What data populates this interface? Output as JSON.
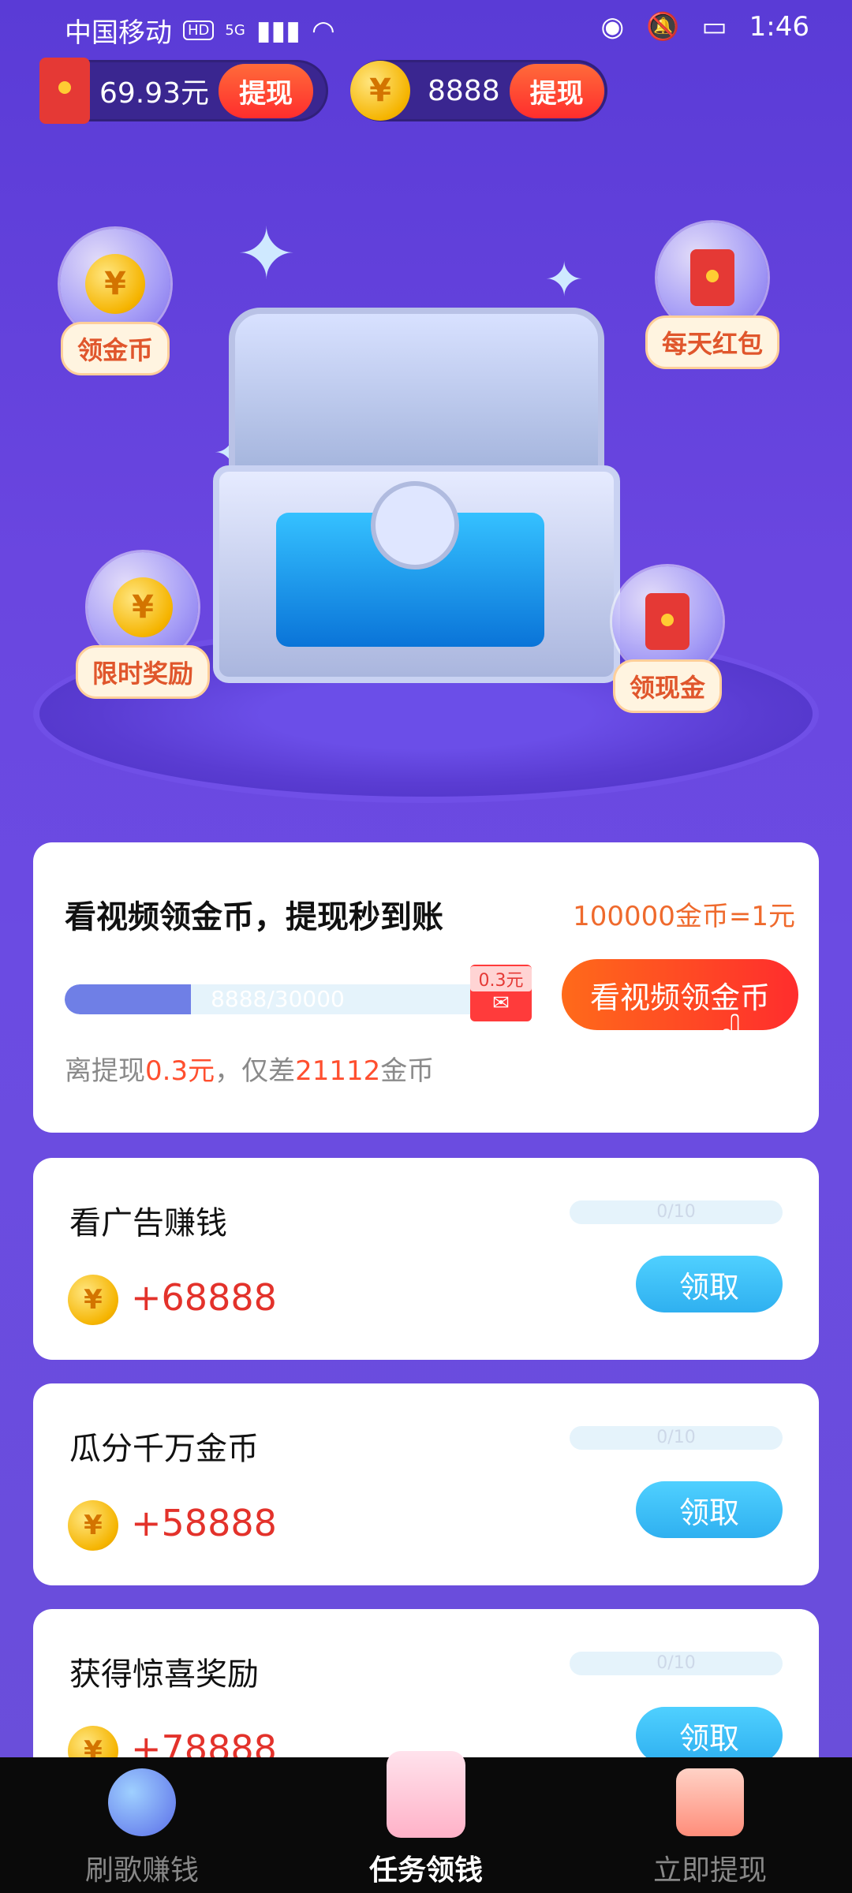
{
  "status_bar": {
    "carrier": "中国移动",
    "hd": "HD",
    "network": "5G",
    "time": "1:46"
  },
  "balances": {
    "cash_amount": "69.93元",
    "cash_withdraw_label": "提现",
    "coin_amount": "8888",
    "coin_withdraw_label": "提现",
    "coin_symbol": "¥"
  },
  "bubbles": {
    "collect_coins": "领金币",
    "daily_redpacket": "每天红包",
    "limited_reward": "限时奖励",
    "collect_cash": "领现金"
  },
  "video_card": {
    "title": "看视频领金币，提现秒到账",
    "rate": "100000金币=1元",
    "progress_text": "8888/30000",
    "progress_fraction": 0.2963,
    "wechat_amount": "0.3元",
    "button_label": "看视频领金币",
    "hint_prefix": "离提现",
    "hint_amount": "0.3元",
    "hint_mid": "，仅差",
    "hint_coins": "21112",
    "hint_suffix": "金币"
  },
  "tasks": [
    {
      "title": "看广告赚钱",
      "progress": "0/10",
      "reward": "+68888",
      "button": "领取"
    },
    {
      "title": "瓜分千万金币",
      "progress": "0/10",
      "reward": "+58888",
      "button": "领取"
    },
    {
      "title": "获得惊喜奖励",
      "progress": "0/10",
      "reward": "+78888",
      "button": "领取"
    }
  ],
  "nav": {
    "items": [
      "刷歌赚钱",
      "任务领钱",
      "立即提现"
    ],
    "active_index": 1
  },
  "colors": {
    "background": "#6a46e0",
    "accent_orange": "#ff6a1a",
    "reward_red": "#e3322b",
    "claim_blue": "#2fb0f0"
  }
}
